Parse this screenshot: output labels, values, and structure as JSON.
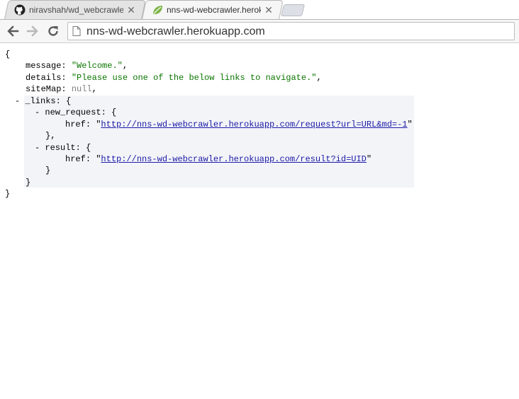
{
  "tabs": [
    {
      "title": "niravshah/wd_webcrawler",
      "active": false,
      "icon": "github-icon"
    },
    {
      "title": "nns-wd-webcrawler.herokuapp.com",
      "active": true,
      "icon": "spring-leaf-icon"
    }
  ],
  "toolbar": {
    "url": "nns-wd-webcrawler.herokuapp.com"
  },
  "json": {
    "open_brace": "{",
    "close_brace": "}",
    "message_key": "message",
    "message_value": "\"Welcome.\"",
    "details_key": "details",
    "details_value": "\"Please use one of the below links to navigate.\"",
    "sitemap_key": "siteMap",
    "sitemap_value": "null",
    "links_key": "_links",
    "new_request_key": "new_request",
    "href_key": "href",
    "new_request_href": "http://nns-wd-webcrawler.herokuapp.com/request?url=URL&md=-1",
    "result_key": "result",
    "result_href": "http://nns-wd-webcrawler.herokuapp.com/result?id=UID",
    "toggle": "-"
  },
  "colors": {
    "string": "#0b7500",
    "null": "#7e7e7e",
    "link": "#1a1aa6",
    "collapsible_bg": "#f3f4f8"
  }
}
